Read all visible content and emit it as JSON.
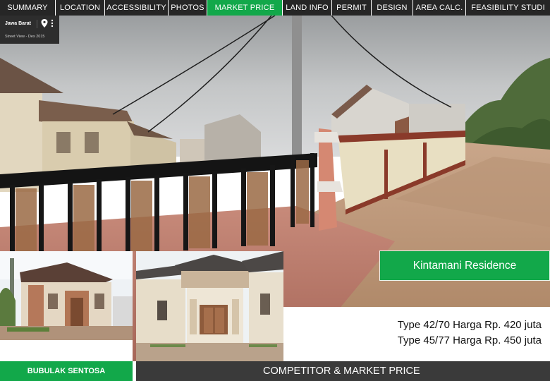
{
  "nav": {
    "tabs": [
      {
        "label": "SUMMARY",
        "active": false
      },
      {
        "label": "LOCATION",
        "active": false
      },
      {
        "label": "ACCESSIBILITY",
        "active": false
      },
      {
        "label": "PHOTOS",
        "active": false
      },
      {
        "label": "MARKET PRICE",
        "active": true
      },
      {
        "label": "LAND INFO",
        "active": false
      },
      {
        "label": "PERMIT",
        "active": false
      },
      {
        "label": "DESIGN",
        "active": false
      },
      {
        "label": "AREA CALC.",
        "active": false
      },
      {
        "label": "FEASIBILITY  STUDI",
        "active": false
      }
    ]
  },
  "street_view": {
    "location": "Jawa Barat",
    "date": "Street View - Des 2015",
    "icons": [
      "map-pin-icon",
      "more-vert-icon"
    ]
  },
  "project": {
    "name": "Kintamani Residence",
    "prices": [
      "Type 42/70 Harga Rp. 420 juta",
      "Type 45/77 Harga Rp. 450 juta"
    ]
  },
  "competitor": {
    "name": "BUBULAK SENTOSA"
  },
  "section": {
    "title": "COMPETITOR & MARKET PRICE"
  },
  "colors": {
    "accent": "#12a84a",
    "nav_bg": "#262626",
    "bottom_bar": "#3a3a3a"
  }
}
